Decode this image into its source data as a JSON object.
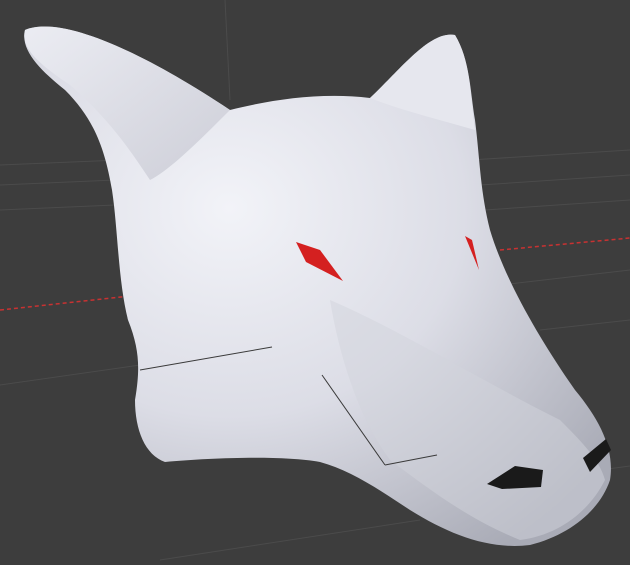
{
  "viewport": {
    "type": "3d-viewport",
    "object": "wolf-head-mesh",
    "colors": {
      "background": "#3d3d3d",
      "grid": "#4a4a4a",
      "x_axis": "#c83232",
      "mesh": "#e4e5ec",
      "eyes": "#d42020",
      "nose": "#1a1a1a"
    }
  }
}
